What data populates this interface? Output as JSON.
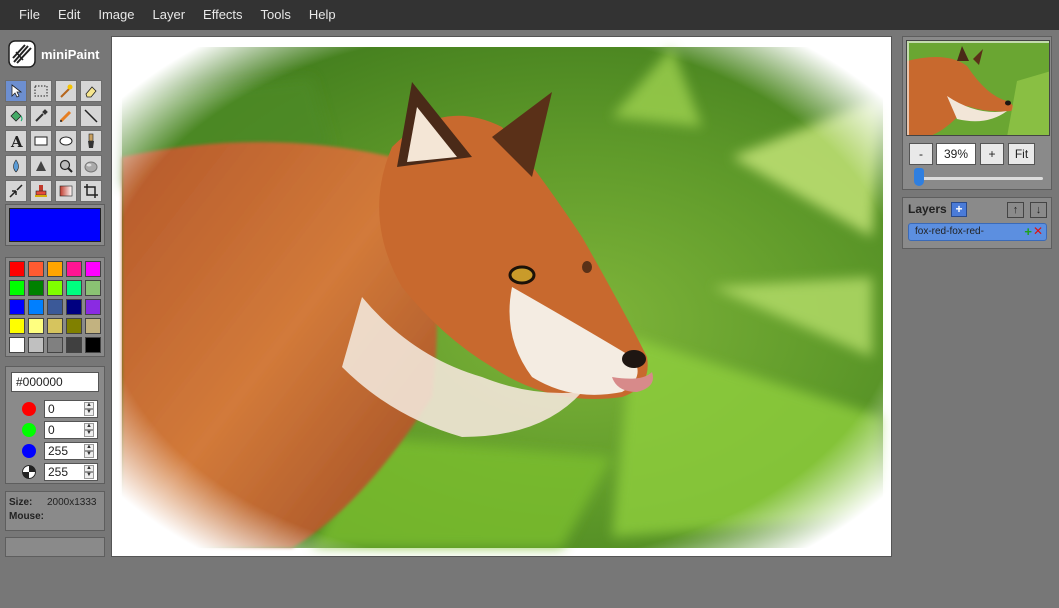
{
  "app": {
    "name": "miniPaint"
  },
  "menu": [
    "File",
    "Edit",
    "Image",
    "Layer",
    "Effects",
    "Tools",
    "Help"
  ],
  "tools": [
    {
      "name": "select-tool",
      "icon": "cursor-icon"
    },
    {
      "name": "rect-select-tool",
      "icon": "dotted-rect-icon"
    },
    {
      "name": "magic-wand-tool",
      "icon": "magic-wand-icon"
    },
    {
      "name": "erase-tool",
      "icon": "eraser-icon"
    },
    {
      "name": "fill-tool",
      "icon": "paint-bucket-icon"
    },
    {
      "name": "pick-color-tool",
      "icon": "eyedropper-icon"
    },
    {
      "name": "pencil-tool",
      "icon": "pencil-icon"
    },
    {
      "name": "line-tool",
      "icon": "line-icon"
    },
    {
      "name": "text-tool",
      "icon": "text-icon"
    },
    {
      "name": "rectangle-tool",
      "icon": "rectangle-icon"
    },
    {
      "name": "ellipse-tool",
      "icon": "ellipse-icon"
    },
    {
      "name": "brush-tool",
      "icon": "brush-icon"
    },
    {
      "name": "blur-tool",
      "icon": "drop-icon"
    },
    {
      "name": "sharpen-tool",
      "icon": "triangle-icon"
    },
    {
      "name": "desaturate-tool",
      "icon": "magnifier-icon"
    },
    {
      "name": "bulge-tool",
      "icon": "sphere-icon"
    },
    {
      "name": "shrink-tool",
      "icon": "arrows-in-icon"
    },
    {
      "name": "clone-tool",
      "icon": "stamp-icon"
    },
    {
      "name": "gradient-tool",
      "icon": "gradient-icon"
    },
    {
      "name": "crop-tool",
      "icon": "crop-icon"
    }
  ],
  "active_color": "#0000ff",
  "palette": [
    "#ff0000",
    "#ff5b31",
    "#ffa500",
    "#ff1493",
    "#ff00ff",
    "#00ff00",
    "#008000",
    "#7fff00",
    "#00ff7f",
    "#8ac273",
    "#0000ff",
    "#007fff",
    "#3b5998",
    "#000080",
    "#8a2be2",
    "#ffff00",
    "#ffff80",
    "#d6c45e",
    "#808000",
    "#c2b280",
    "#ffffff",
    "#c0c0c0",
    "#808080",
    "#404040",
    "#000000"
  ],
  "color_panel": {
    "hex": "#000000",
    "channels": [
      {
        "name": "red",
        "value": "0",
        "dot": "#ff0000"
      },
      {
        "name": "green",
        "value": "0",
        "dot": "#00ff00"
      },
      {
        "name": "blue",
        "value": "255",
        "dot": "#0000ff"
      },
      {
        "name": "alpha",
        "value": "255",
        "dot": "checker"
      }
    ]
  },
  "info": {
    "size_label": "Size:",
    "size_value": "2000x1333",
    "mouse_label": "Mouse:",
    "mouse_value": ""
  },
  "zoom": {
    "minus_label": "-",
    "value": "39%",
    "plus_label": "+",
    "fit_label": "Fit",
    "slider_fraction": 0.03
  },
  "layers": {
    "title": "Layers",
    "add_label": "+",
    "up_label": "↑",
    "down_label": "↓",
    "items": [
      {
        "name": "fox-red-fox-red-"
      }
    ]
  }
}
